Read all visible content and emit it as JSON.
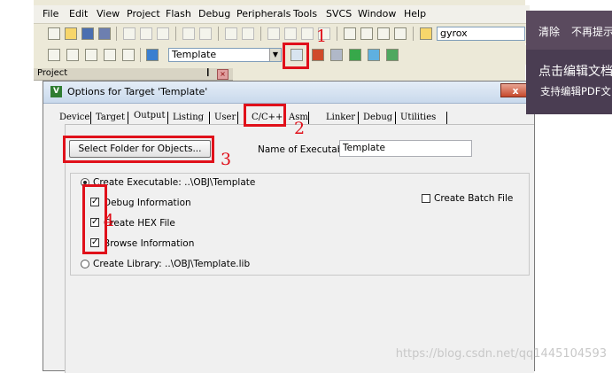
{
  "menubar": {
    "items": [
      "File",
      "Edit",
      "View",
      "Project",
      "Flash",
      "Debug",
      "Peripherals",
      "Tools",
      "SVCS",
      "Window",
      "Help"
    ]
  },
  "toolbar": {
    "search_value": "gyrox",
    "target_value": "Template"
  },
  "project_panel": {
    "title": "Project",
    "pin": "❙",
    "close": "×"
  },
  "dialog": {
    "title": "Options for Target 'Template'",
    "close_label": "x",
    "tabs": [
      "Device",
      "Target",
      "Output",
      "Listing",
      "User",
      "C/C++",
      "Asm",
      "Linker",
      "Debug",
      "Utilities"
    ],
    "active_tab": "Output",
    "select_folder_label": "Select Folder for Objects...",
    "name_exec_label": "Name of Executable:",
    "name_exec_value": "Template",
    "create_exec_label": "Create Executable:  ..\\OBJ\\Template",
    "debug_info_label": "Debug Information",
    "hex_label": "Create HEX File",
    "browse_label": "Browse Information",
    "batch_label": "Create Batch File",
    "library_label": "Create Library:  ..\\OBJ\\Template.lib"
  },
  "annotations": {
    "n1": "1",
    "n2": "2",
    "n3": "3",
    "n4": "4"
  },
  "overlay": {
    "clear": "清除",
    "no_prompt": "不再提示",
    "edit_doc": "点击编辑文档",
    "support_pdf": "支持编辑PDF文"
  },
  "watermark": "https://blog.csdn.net/qq1445104593",
  "colors": {
    "annotation_red": "#e0101a",
    "overlay_bg": "#5a4a5e"
  }
}
